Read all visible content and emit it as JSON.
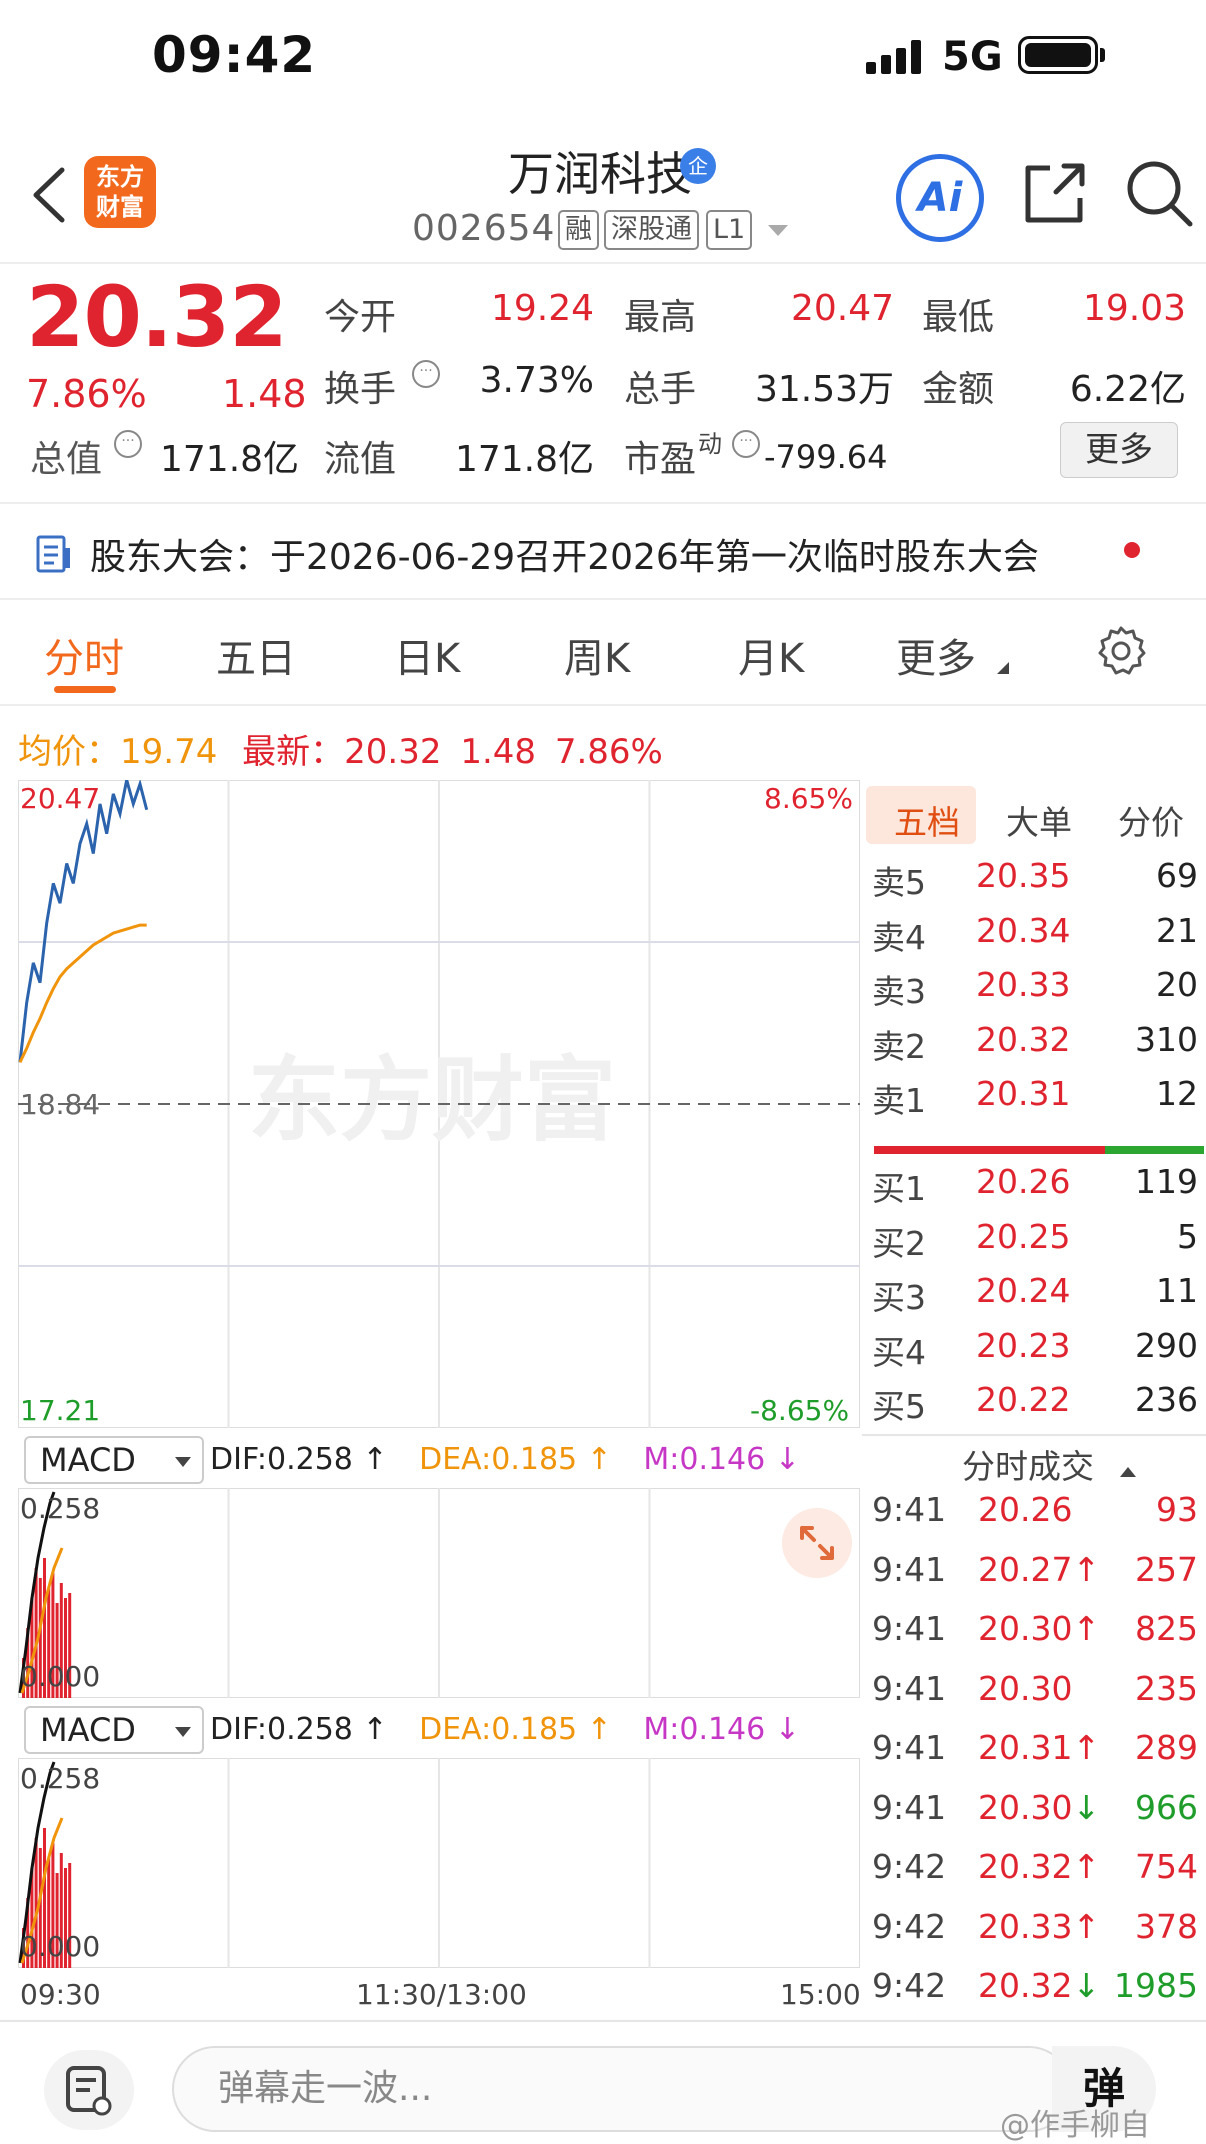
{
  "status": {
    "time": "09:42",
    "network": "5G"
  },
  "header": {
    "logo_line1": "东方",
    "logo_line2": "财富",
    "name": "万润科技",
    "badge": "企",
    "code": "002654",
    "tags": [
      "融",
      "深股通",
      "L1"
    ],
    "ai_label": "Ai"
  },
  "quote": {
    "price": "20.32",
    "change_pct": "7.86%",
    "change": "1.48",
    "open_label": "今开",
    "open": "19.24",
    "high_label": "最高",
    "high": "20.47",
    "low_label": "最低",
    "low": "19.03",
    "turnover_label": "换手",
    "turnover": "3.73%",
    "volume_label": "总手",
    "volume": "31.53万",
    "amount_label": "金额",
    "amount": "6.22亿",
    "mktcap_label": "总值",
    "mktcap": "171.8亿",
    "float_label": "流值",
    "float_cap": "171.8亿",
    "pe_label": "市盈",
    "pe_sup": "动",
    "pe": "-799.64",
    "more_label": "更多"
  },
  "notice": {
    "text": "股东大会：于2026-06-29召开2026年第一次临时股东大会"
  },
  "tabs": [
    "分时",
    "五日",
    "日K",
    "周K",
    "月K",
    "更多"
  ],
  "summary": {
    "avg_label": "均价：",
    "avg": "19.74",
    "latest_label": "最新：",
    "latest": "20.32",
    "change": "1.48",
    "change_pct": "7.86%"
  },
  "chart_data": {
    "type": "line",
    "title": "",
    "prev_close": 18.84,
    "ylim": [
      17.21,
      20.47
    ],
    "y_top_label": "20.47",
    "y_mid_label": "18.84",
    "y_bottom_label": "17.21",
    "pct_top_label": "8.65%",
    "pct_bottom_label": "-8.65%",
    "x_labels": [
      "09:30",
      "11:30/13:00",
      "15:00"
    ],
    "total_minutes": 240,
    "series": [
      {
        "values": [
          19.05,
          19.35,
          19.55,
          19.45,
          19.75,
          19.95,
          19.85,
          20.05,
          19.95,
          20.15,
          20.25,
          20.1,
          20.35,
          20.2,
          20.4,
          20.3,
          20.47,
          20.35,
          20.45,
          20.32
        ],
        "color": "#2b63ad"
      },
      {
        "values": [
          19.05,
          19.12,
          19.2,
          19.27,
          19.35,
          19.42,
          19.48,
          19.52,
          19.55,
          19.58,
          19.61,
          19.64,
          19.66,
          19.68,
          19.7,
          19.71,
          19.72,
          19.73,
          19.74,
          19.74
        ],
        "color": "#f0940c"
      }
    ]
  },
  "orderbook": {
    "tabs": [
      "五档",
      "大单",
      "分价"
    ],
    "asks": [
      {
        "label": "卖5",
        "price": "20.35",
        "vol": "69"
      },
      {
        "label": "卖4",
        "price": "20.34",
        "vol": "21"
      },
      {
        "label": "卖3",
        "price": "20.33",
        "vol": "20"
      },
      {
        "label": "卖2",
        "price": "20.32",
        "vol": "310"
      },
      {
        "label": "卖1",
        "price": "20.31",
        "vol": "12"
      }
    ],
    "bids": [
      {
        "label": "买1",
        "price": "20.26",
        "vol": "119"
      },
      {
        "label": "买2",
        "price": "20.25",
        "vol": "5"
      },
      {
        "label": "买3",
        "price": "20.24",
        "vol": "11"
      },
      {
        "label": "买4",
        "price": "20.23",
        "vol": "290"
      },
      {
        "label": "买5",
        "price": "20.22",
        "vol": "236"
      }
    ],
    "buy_ratio": 0.7
  },
  "trades": {
    "title": "分时成交",
    "rows": [
      {
        "time": "9:41",
        "price": "20.26",
        "vol": "93",
        "dir": "",
        "vol_color": "red"
      },
      {
        "time": "9:41",
        "price": "20.27↑",
        "vol": "257",
        "dir": "up",
        "vol_color": "red"
      },
      {
        "time": "9:41",
        "price": "20.30↑",
        "vol": "825",
        "dir": "up",
        "vol_color": "red"
      },
      {
        "time": "9:41",
        "price": "20.30",
        "vol": "235",
        "dir": "",
        "vol_color": "red"
      },
      {
        "time": "9:41",
        "price": "20.31↑",
        "vol": "289",
        "dir": "up",
        "vol_color": "red"
      },
      {
        "time": "9:41",
        "price": "20.30↓",
        "vol": "966",
        "dir": "down",
        "vol_color": "green"
      },
      {
        "time": "9:42",
        "price": "20.32↑",
        "vol": "754",
        "dir": "up",
        "vol_color": "red"
      },
      {
        "time": "9:42",
        "price": "20.33↑",
        "vol": "378",
        "dir": "up",
        "vol_color": "red"
      },
      {
        "time": "9:42",
        "price": "20.32↓",
        "vol": "1985",
        "dir": "down",
        "vol_color": "green"
      }
    ]
  },
  "macd": {
    "indicator": "MACD",
    "dif": "DIF:0.258 ↑",
    "dea": "DEA:0.185 ↑",
    "m": "M:0.146 ↓",
    "top_label": "0.258",
    "bottom_label": "0.000"
  },
  "bottom": {
    "placeholder": "弹幕走一波...",
    "danmu_label": "弹",
    "watermark": "@作手柳自"
  },
  "colors": {
    "up": "#e0242f",
    "down": "#1f9d2a",
    "accent": "#f2691d",
    "avg": "#f0940c",
    "price_line": "#2b63ad"
  }
}
